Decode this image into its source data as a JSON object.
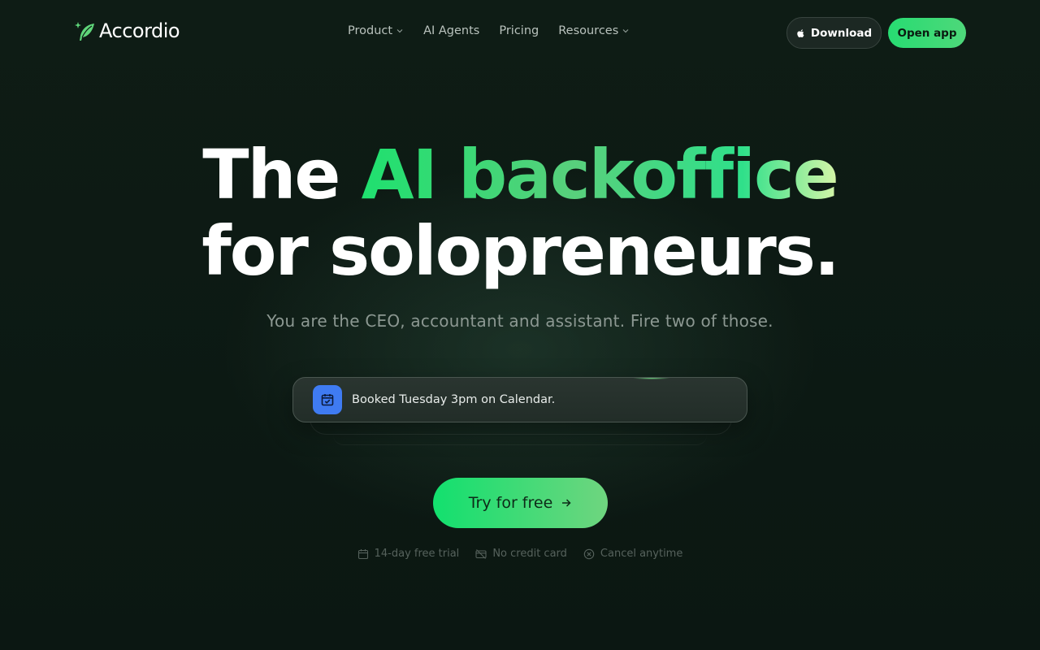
{
  "brand": {
    "name": "Accordio",
    "accent": "#27dc72"
  },
  "nav": {
    "items": [
      {
        "label": "Product",
        "has_dropdown": true
      },
      {
        "label": "AI Agents",
        "has_dropdown": false
      },
      {
        "label": "Pricing",
        "has_dropdown": false
      },
      {
        "label": "Resources",
        "has_dropdown": true
      }
    ],
    "download_label": "Download",
    "download_icon": "apple-icon",
    "open_app_label": "Open app"
  },
  "hero": {
    "title_line1_plain": "The",
    "title_line1_highlight": "AI backoffice",
    "title_line2": "for solopreneurs.",
    "subtitle": "You are the CEO, accountant and assistant. Fire two of those."
  },
  "notification": {
    "icon": "calendar-check-icon",
    "icon_color": "#3f7bf2",
    "text": "Booked Tuesday 3pm on Calendar."
  },
  "cta": {
    "label": "Try for free",
    "icon": "arrow-right-icon"
  },
  "perks": [
    {
      "icon": "calendar-icon",
      "label": "14-day free trial"
    },
    {
      "icon": "no-credit-card-icon",
      "label": "No credit card"
    },
    {
      "icon": "x-circle-icon",
      "label": "Cancel anytime"
    }
  ]
}
